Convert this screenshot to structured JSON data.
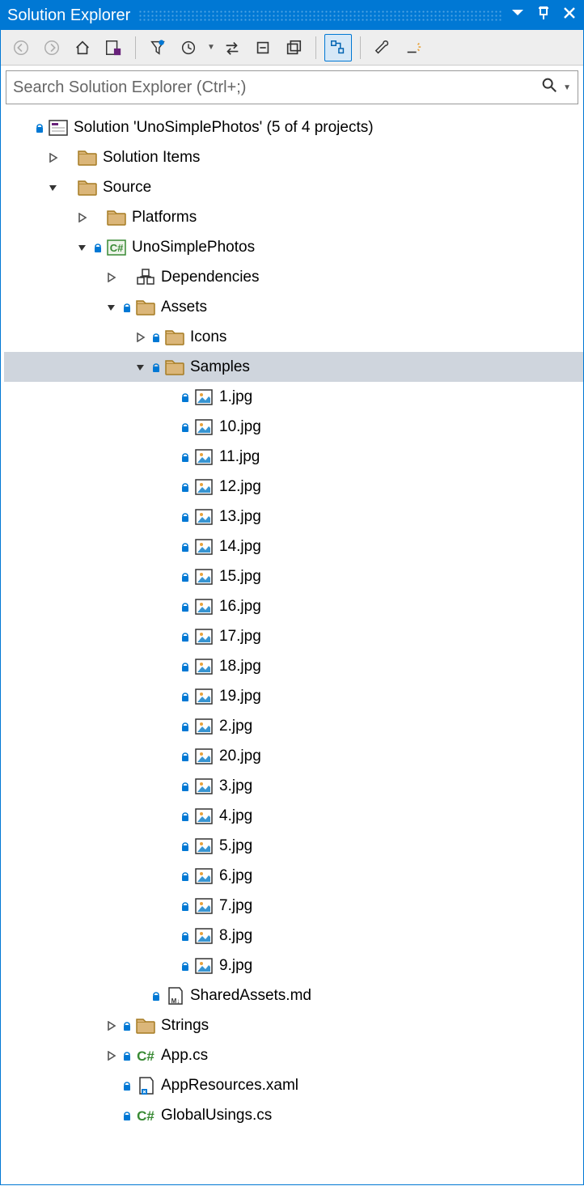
{
  "title": "Solution Explorer",
  "search_placeholder": "Search Solution Explorer (Ctrl+;)",
  "tree": [
    {
      "indent": 0,
      "exp": "none",
      "lock": true,
      "icon": "solution",
      "label": "Solution 'UnoSimplePhotos' (5 of 4 projects)",
      "sel": false
    },
    {
      "indent": 1,
      "exp": "closed",
      "lock": false,
      "icon": "folder",
      "label": "Solution Items",
      "sel": false
    },
    {
      "indent": 1,
      "exp": "open",
      "lock": false,
      "icon": "folder",
      "label": "Source",
      "sel": false
    },
    {
      "indent": 2,
      "exp": "closed",
      "lock": false,
      "icon": "folder",
      "label": "Platforms",
      "sel": false
    },
    {
      "indent": 2,
      "exp": "open",
      "lock": true,
      "icon": "csproj",
      "label": "UnoSimplePhotos",
      "sel": false
    },
    {
      "indent": 3,
      "exp": "closed",
      "lock": false,
      "icon": "deps",
      "label": "Dependencies",
      "sel": false
    },
    {
      "indent": 3,
      "exp": "open",
      "lock": true,
      "icon": "folder",
      "label": "Assets",
      "sel": false
    },
    {
      "indent": 4,
      "exp": "closed",
      "lock": true,
      "icon": "folder",
      "label": "Icons",
      "sel": false
    },
    {
      "indent": 4,
      "exp": "open",
      "lock": true,
      "icon": "folder",
      "label": "Samples",
      "sel": true
    },
    {
      "indent": 5,
      "exp": "none",
      "lock": true,
      "icon": "image",
      "label": "1.jpg",
      "sel": false
    },
    {
      "indent": 5,
      "exp": "none",
      "lock": true,
      "icon": "image",
      "label": "10.jpg",
      "sel": false
    },
    {
      "indent": 5,
      "exp": "none",
      "lock": true,
      "icon": "image",
      "label": "11.jpg",
      "sel": false
    },
    {
      "indent": 5,
      "exp": "none",
      "lock": true,
      "icon": "image",
      "label": "12.jpg",
      "sel": false
    },
    {
      "indent": 5,
      "exp": "none",
      "lock": true,
      "icon": "image",
      "label": "13.jpg",
      "sel": false
    },
    {
      "indent": 5,
      "exp": "none",
      "lock": true,
      "icon": "image",
      "label": "14.jpg",
      "sel": false
    },
    {
      "indent": 5,
      "exp": "none",
      "lock": true,
      "icon": "image",
      "label": "15.jpg",
      "sel": false
    },
    {
      "indent": 5,
      "exp": "none",
      "lock": true,
      "icon": "image",
      "label": "16.jpg",
      "sel": false
    },
    {
      "indent": 5,
      "exp": "none",
      "lock": true,
      "icon": "image",
      "label": "17.jpg",
      "sel": false
    },
    {
      "indent": 5,
      "exp": "none",
      "lock": true,
      "icon": "image",
      "label": "18.jpg",
      "sel": false
    },
    {
      "indent": 5,
      "exp": "none",
      "lock": true,
      "icon": "image",
      "label": "19.jpg",
      "sel": false
    },
    {
      "indent": 5,
      "exp": "none",
      "lock": true,
      "icon": "image",
      "label": "2.jpg",
      "sel": false
    },
    {
      "indent": 5,
      "exp": "none",
      "lock": true,
      "icon": "image",
      "label": "20.jpg",
      "sel": false
    },
    {
      "indent": 5,
      "exp": "none",
      "lock": true,
      "icon": "image",
      "label": "3.jpg",
      "sel": false
    },
    {
      "indent": 5,
      "exp": "none",
      "lock": true,
      "icon": "image",
      "label": "4.jpg",
      "sel": false
    },
    {
      "indent": 5,
      "exp": "none",
      "lock": true,
      "icon": "image",
      "label": "5.jpg",
      "sel": false
    },
    {
      "indent": 5,
      "exp": "none",
      "lock": true,
      "icon": "image",
      "label": "6.jpg",
      "sel": false
    },
    {
      "indent": 5,
      "exp": "none",
      "lock": true,
      "icon": "image",
      "label": "7.jpg",
      "sel": false
    },
    {
      "indent": 5,
      "exp": "none",
      "lock": true,
      "icon": "image",
      "label": "8.jpg",
      "sel": false
    },
    {
      "indent": 5,
      "exp": "none",
      "lock": true,
      "icon": "image",
      "label": "9.jpg",
      "sel": false
    },
    {
      "indent": 4,
      "exp": "none",
      "lock": true,
      "icon": "md",
      "label": "SharedAssets.md",
      "sel": false
    },
    {
      "indent": 3,
      "exp": "closed",
      "lock": true,
      "icon": "folder",
      "label": "Strings",
      "sel": false
    },
    {
      "indent": 3,
      "exp": "closed",
      "lock": true,
      "icon": "cs",
      "label": "App.cs",
      "sel": false
    },
    {
      "indent": 3,
      "exp": "none",
      "lock": true,
      "icon": "xaml",
      "label": "AppResources.xaml",
      "sel": false
    },
    {
      "indent": 3,
      "exp": "none",
      "lock": true,
      "icon": "cs",
      "label": "GlobalUsings.cs",
      "sel": false
    }
  ]
}
